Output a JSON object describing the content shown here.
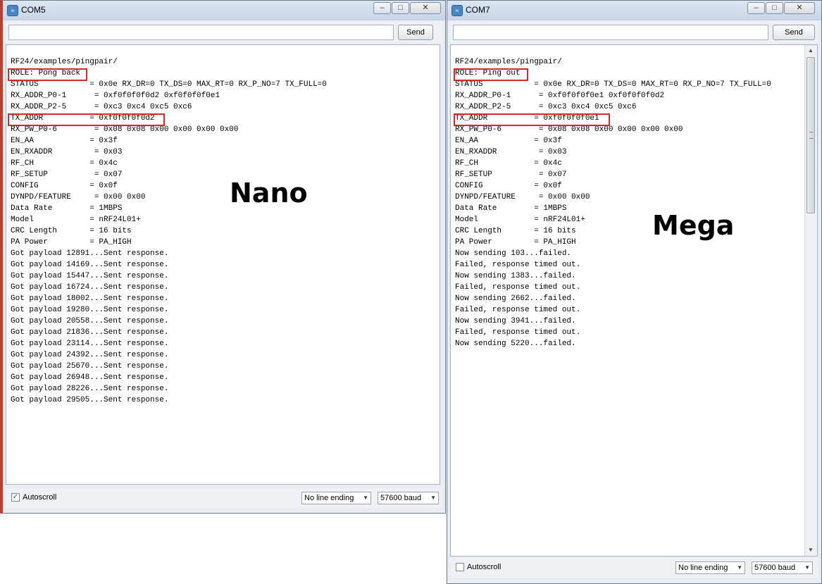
{
  "left": {
    "title": "COM5",
    "send_label": "Send",
    "send_value": "",
    "lines": [
      "RF24/examples/pingpair/",
      "ROLE: Pong back",
      "STATUS           = 0x0e RX_DR=0 TX_DS=0 MAX_RT=0 RX_P_NO=7 TX_FULL=0",
      "RX_ADDR_P0-1      = 0xf0f0f0f0d2 0xf0f0f0f0e1",
      "RX_ADDR_P2-5      = 0xc3 0xc4 0xc5 0xc6",
      "TX_ADDR          = 0xf0f0f0f0d2",
      "RX_PW_P0-6        = 0x08 0x08 0x00 0x00 0x00 0x00",
      "EN_AA            = 0x3f",
      "EN_RXADDR         = 0x03",
      "RF_CH            = 0x4c",
      "RF_SETUP          = 0x07",
      "CONFIG           = 0x0f",
      "DYNPD/FEATURE     = 0x00 0x00",
      "Data Rate        = 1MBPS",
      "Model            = nRF24L01+",
      "CRC Length       = 16 bits",
      "PA Power         = PA_HIGH",
      "Got payload 12891...Sent response.",
      "Got payload 14169...Sent response.",
      "Got payload 15447...Sent response.",
      "Got payload 16724...Sent response.",
      "Got payload 18002...Sent response.",
      "Got payload 19280...Sent response.",
      "Got payload 20558...Sent response.",
      "Got payload 21836...Sent response.",
      "Got payload 23114...Sent response.",
      "Got payload 24392...Sent response.",
      "Got payload 25670...Sent response.",
      "Got payload 26948...Sent response.",
      "Got payload 28226...Sent response.",
      "Got payload 29505...Sent response."
    ],
    "label": "Nano",
    "autoscroll_label": "Autoscroll",
    "autoscroll_checked": true,
    "line_ending": "No line ending",
    "baud": "57600 baud"
  },
  "right": {
    "title": "COM7",
    "send_label": "Send",
    "send_value": "",
    "lines": [
      "RF24/examples/pingpair/",
      "ROLE: Ping out",
      "STATUS           = 0x0e RX_DR=0 TX_DS=0 MAX_RT=0 RX_P_NO=7 TX_FULL=0",
      "RX_ADDR_P0-1      = 0xf0f0f0f0e1 0xf0f0f0f0d2",
      "RX_ADDR_P2-5      = 0xc3 0xc4 0xc5 0xc6",
      "TX_ADDR          = 0xf0f0f0f0e1",
      "RX_PW_P0-6        = 0x08 0x08 0x00 0x00 0x00 0x00",
      "EN_AA            = 0x3f",
      "EN_RXADDR         = 0x03",
      "RF_CH            = 0x4c",
      "RF_SETUP          = 0x07",
      "CONFIG           = 0x0f",
      "DYNPD/FEATURE     = 0x00 0x00",
      "Data Rate        = 1MBPS",
      "Model            = nRF24L01+",
      "CRC Length       = 16 bits",
      "PA Power         = PA_HIGH",
      "Now sending 103...failed.",
      "Failed, response timed out.",
      "Now sending 1383...failed.",
      "Failed, response timed out.",
      "Now sending 2662...failed.",
      "Failed, response timed out.",
      "Now sending 3941...failed.",
      "Failed, response timed out.",
      "Now sending 5220...failed."
    ],
    "label": "Mega",
    "autoscroll_label": "Autoscroll",
    "autoscroll_checked": false,
    "line_ending": "No line ending",
    "baud": "57600 baud"
  },
  "window_controls": {
    "minimize": "–",
    "maximize": "□",
    "close": "✕"
  },
  "icons": {
    "app": "serial-monitor-icon",
    "checkbox_mark": "✓",
    "dropdown": "▼",
    "scroll_up": "▲",
    "scroll_down": "▼"
  },
  "colors": {
    "highlight_box": "#d42a2a"
  }
}
